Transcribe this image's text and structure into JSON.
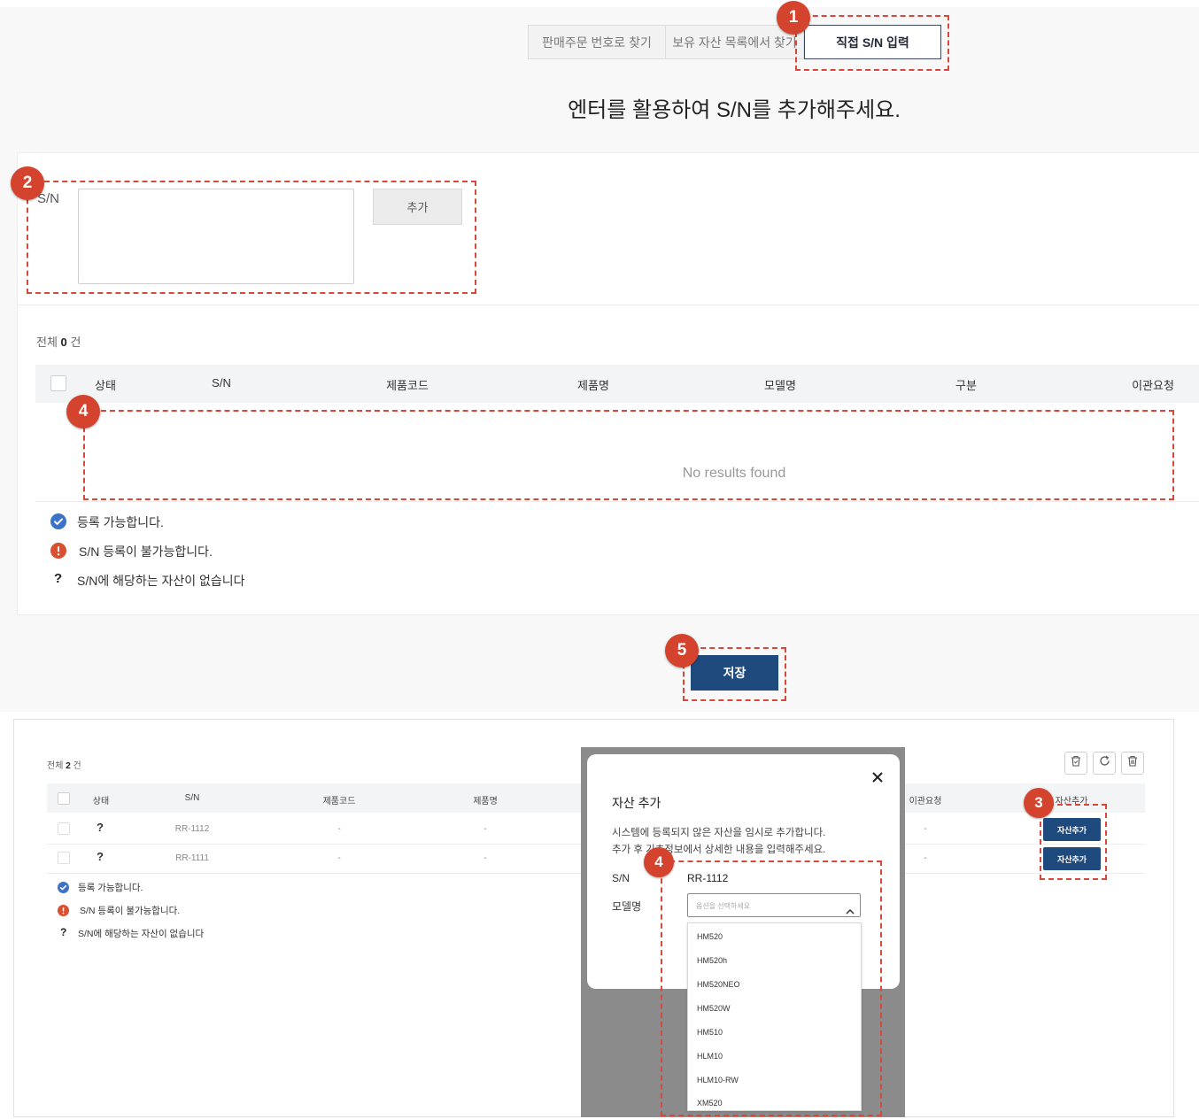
{
  "tabs": [
    {
      "label": "판매주문 번호로 찾기"
    },
    {
      "label": "보유 자산 목록에서 찾기"
    },
    {
      "label": "직접 S/N 입력"
    }
  ],
  "selected_tab": 2,
  "heading": "엔터를 활용하여 S/N를 추가해주세요.",
  "sn_form": {
    "label": "S/N",
    "value": "",
    "add_button": "추가"
  },
  "summary": {
    "prefix": "전체",
    "count": "0",
    "suffix": "건"
  },
  "table": {
    "columns": [
      "상태",
      "S/N",
      "제품코드",
      "제품명",
      "모델명",
      "구분",
      "이관요청"
    ],
    "empty_text": "No results found"
  },
  "legend": [
    {
      "icon": "check-circle-icon",
      "text": "등록 가능합니다."
    },
    {
      "icon": "alert-circle-icon",
      "text": "S/N 등록이 불가능합니다."
    },
    {
      "icon": "question-icon",
      "glyph": "?",
      "text": "S/N에 해당하는 자산이 없습니다"
    }
  ],
  "save_button": "저장",
  "callouts": {
    "tabs": "1",
    "sn_form": "2",
    "add_asset": "3",
    "results": "4",
    "model_select": "4",
    "save": "5"
  },
  "detail": {
    "summary": {
      "prefix": "전체",
      "count": "2",
      "suffix": "건"
    },
    "toolbar_icons": [
      "trash-restore-icon",
      "refresh-icon",
      "trash-icon"
    ],
    "columns": [
      "상태",
      "S/N",
      "제품코드",
      "제품명",
      "이관요청",
      "자산추가"
    ],
    "rows": [
      {
        "status": "?",
        "sn": "RR-1112",
        "product_code": "-",
        "product_name": "-",
        "transfer": "-",
        "action": "자산추가"
      },
      {
        "status": "?",
        "sn": "RR-1111",
        "product_code": "-",
        "product_name": "-",
        "transfer": "-",
        "action": "자산추가"
      }
    ],
    "modal": {
      "title": "자산 추가",
      "desc": [
        "시스템에 등록되지 않은 자산을 임시로 추가합니다.",
        "추가 후 기초정보에서 상세한 내용을 입력해주세요."
      ],
      "sn_label": "S/N",
      "sn_value": "RR-1112",
      "model_label": "모델명",
      "model_placeholder": "옵션을 선택하세요",
      "options": [
        "HM520",
        "HM520h",
        "HM520NEO",
        "HM520W",
        "HM510",
        "HLM10",
        "HLM10-RW",
        "XM520"
      ]
    }
  },
  "colors": {
    "primary": "#1e4a7e",
    "callout": "#d4432d",
    "success": "#3b73c9",
    "error": "#d94f30",
    "overlay": "#8b8b8b"
  }
}
